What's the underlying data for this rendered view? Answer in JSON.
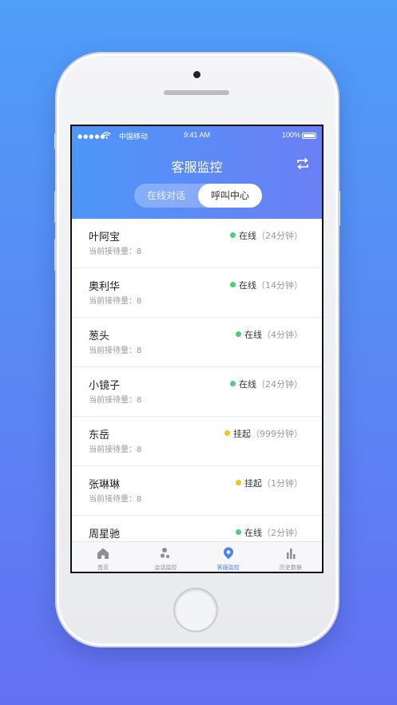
{
  "status_bar": {
    "carrier": "中国移动",
    "time": "9:41 AM",
    "battery": "100%"
  },
  "header": {
    "title": "客服监控",
    "switch_icon": "swap-icon"
  },
  "segment": {
    "left_label": "在线对话",
    "right_label": "呼叫中心",
    "selected": "呼叫中心"
  },
  "colors": {
    "online": "#4cd07d",
    "suspended": "#f5c518",
    "accent": "#4d7ff5"
  },
  "agents": [
    {
      "name": "叶阿宝",
      "queue": "当前接待量：8",
      "status": "在线",
      "duration": "（24分钟）",
      "state": "online"
    },
    {
      "name": "奥利华",
      "queue": "当前接待量：8",
      "status": "在线",
      "duration": "（14分钟）",
      "state": "online"
    },
    {
      "name": "葱头",
      "queue": "当前接待量：8",
      "status": "在线",
      "duration": "（4分钟）",
      "state": "online"
    },
    {
      "name": "小镜子",
      "queue": "当前接待量：8",
      "status": "在线",
      "duration": "（24分钟）",
      "state": "online"
    },
    {
      "name": "东岳",
      "queue": "当前接待量：8",
      "status": "挂起",
      "duration": "（999分钟）",
      "state": "suspended"
    },
    {
      "name": "张琳琳",
      "queue": "当前接待量：8",
      "status": "挂起",
      "duration": "（1分钟）",
      "state": "suspended"
    },
    {
      "name": "周星驰",
      "queue": "",
      "status": "在线",
      "duration": "（2分钟）",
      "state": "online"
    }
  ],
  "tabbar": [
    {
      "label": "首页",
      "icon": "home-icon"
    },
    {
      "label": "会话监控",
      "icon": "chat-monitor-icon"
    },
    {
      "label": "客服监控",
      "icon": "agent-monitor-icon",
      "active": true
    },
    {
      "label": "历史数据",
      "icon": "bar-chart-icon"
    }
  ]
}
